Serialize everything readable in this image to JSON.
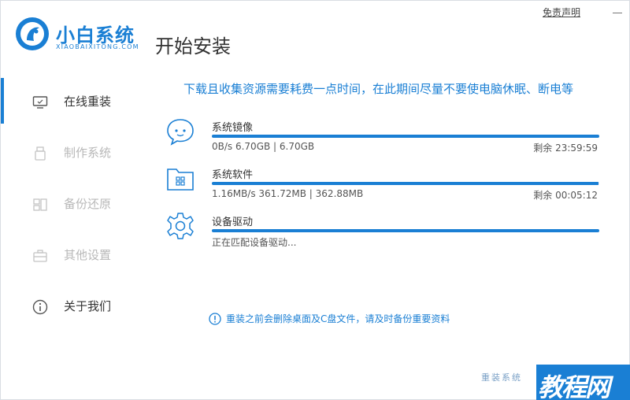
{
  "app": {
    "name": "小白系统",
    "subtitle": "XIAOBAIXITONG.COM",
    "page_title": "开始安装",
    "disclaimer": "免责声明"
  },
  "sidebar": {
    "items": [
      {
        "label": "在线重装",
        "icon": "monitor-icon",
        "state": "active"
      },
      {
        "label": "制作系统",
        "icon": "usb-drive-icon",
        "state": "disabled"
      },
      {
        "label": "备份还原",
        "icon": "backup-icon",
        "state": "disabled"
      },
      {
        "label": "其他设置",
        "icon": "toolbox-icon",
        "state": "disabled"
      },
      {
        "label": "关于我们",
        "icon": "info-icon",
        "state": "normal"
      }
    ]
  },
  "main": {
    "notice": "下载且收集资源需要耗费一点时间，在此期间尽量不要使电脑休眠、断电等",
    "tasks": [
      {
        "name": "系统镜像",
        "detail": "0B/s 6.70GB | 6.70GB",
        "remaining": "剩余 23:59:59",
        "icon": "chat-face-icon",
        "progress": 1.0
      },
      {
        "name": "系统软件",
        "detail": "1.16MB/s 361.72MB | 362.88MB",
        "remaining": "剩余 00:05:12",
        "icon": "folder-apps-icon",
        "progress": 0.997
      },
      {
        "name": "设备驱动",
        "detail": "正在匹配设备驱动...",
        "remaining": "",
        "icon": "gear-icon",
        "progress": 1.0
      }
    ],
    "warning": "重装之前会删除桌面及C盘文件，请及时备份重要资料"
  },
  "watermark": {
    "small": "重装系统",
    "big": "教程网"
  },
  "colors": {
    "accent": "#1a7fd4",
    "track": "#e6ecf5",
    "disabled": "#b8b8b8"
  }
}
